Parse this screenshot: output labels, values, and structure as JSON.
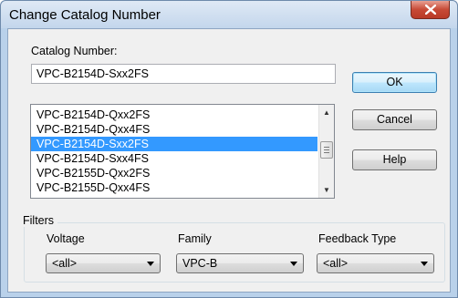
{
  "window": {
    "title": "Change Catalog Number",
    "close_icon": "close-icon"
  },
  "catalog_number": {
    "label": "Catalog Number:",
    "value": "VPC-B2154D-Sxx2FS"
  },
  "list": {
    "items": [
      "VPC-B2154D-Qxx2FS",
      "VPC-B2154D-Qxx4FS",
      "VPC-B2154D-Sxx2FS",
      "VPC-B2154D-Sxx4FS",
      "VPC-B2155D-Qxx2FS",
      "VPC-B2155D-Qxx4FS"
    ],
    "selected_index": 2
  },
  "buttons": {
    "ok": "OK",
    "cancel": "Cancel",
    "help": "Help"
  },
  "filters": {
    "title": "Filters",
    "voltage": {
      "label": "Voltage",
      "value": "<all>"
    },
    "family": {
      "label": "Family",
      "value": "VPC-B"
    },
    "feedback_type": {
      "label": "Feedback Type",
      "value": "<all>"
    }
  },
  "colors": {
    "selection": "#3399ff",
    "close_button": "#c74a36",
    "title_bar": "#c3d6ec"
  }
}
